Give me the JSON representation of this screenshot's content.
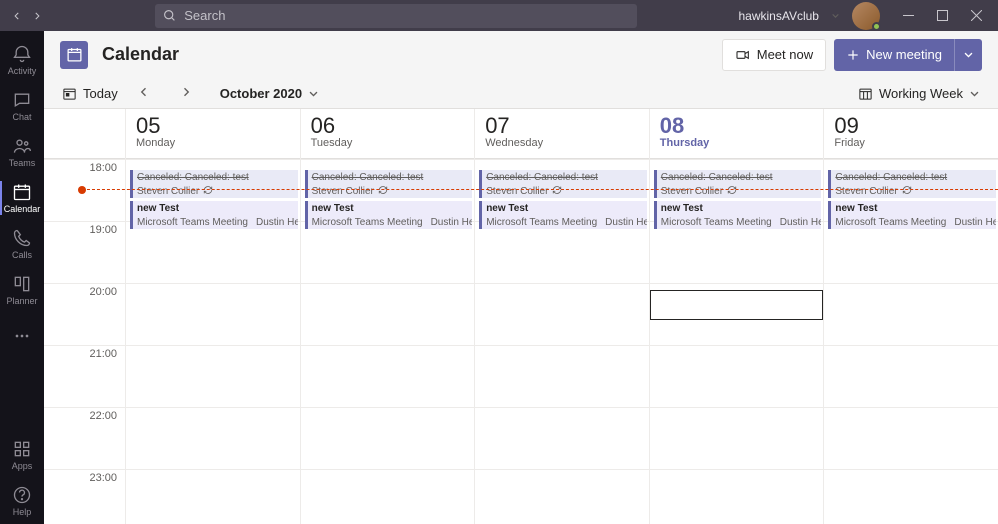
{
  "titlebar": {
    "user": "hawkinsAVclub",
    "search_placeholder": "Search"
  },
  "sidebar": {
    "items": [
      {
        "label": "Activity"
      },
      {
        "label": "Chat"
      },
      {
        "label": "Teams"
      },
      {
        "label": "Calendar"
      },
      {
        "label": "Calls"
      },
      {
        "label": "Planner"
      }
    ],
    "apps_label": "Apps",
    "help_label": "Help"
  },
  "header": {
    "title": "Calendar",
    "meet_now": "Meet now",
    "new_meeting": "New meeting"
  },
  "toolbar": {
    "today": "Today",
    "month": "October 2020",
    "view": "Working Week"
  },
  "days": [
    {
      "num": "05",
      "name": "Monday",
      "today": false
    },
    {
      "num": "06",
      "name": "Tuesday",
      "today": false
    },
    {
      "num": "07",
      "name": "Wednesday",
      "today": false
    },
    {
      "num": "08",
      "name": "Thursday",
      "today": true
    },
    {
      "num": "09",
      "name": "Friday",
      "today": false
    }
  ],
  "hours": [
    "18:00",
    "19:00",
    "20:00",
    "21:00",
    "22:00",
    "23:00"
  ],
  "event_templates": {
    "canceled_title": "Canceled: Canceled: test",
    "canceled_organizer": "Steven Collier",
    "new_title": "new Test",
    "new_detail": "Microsoft Teams Meeting",
    "new_attendee": "Dustin He"
  },
  "now_indicator_hour_fraction": 2.24,
  "selection_day_index": 3,
  "selection_hour_fraction": 2.12
}
